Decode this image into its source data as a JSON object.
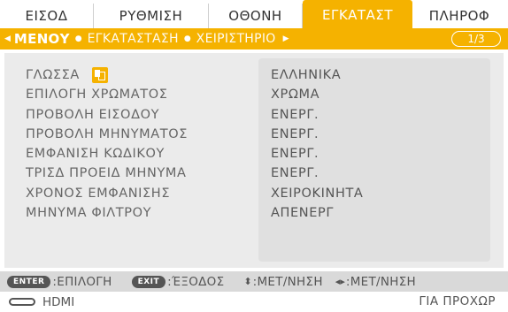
{
  "tabs": [
    {
      "label": "ΕΙΣΟΔ"
    },
    {
      "label": "ΡΥΘΜΙΣΗ"
    },
    {
      "label": "ΟΘΟΝΗ"
    },
    {
      "label": "ΕΓΚΑΤΑΣΤ"
    },
    {
      "label": "ΠΛΗΡΟΦ"
    }
  ],
  "active_tab": "ΕΓΚΑΤΑΣΤ",
  "subnav": {
    "active": "ΜΕΝΟΥ",
    "item2": "ΕΓΚΑΤΑΣΤΑΣΗ",
    "item3": "ΧΕΙΡΙΣΤΗΡΙΟ",
    "page_indicator": "1/3"
  },
  "settings": [
    {
      "label": "ΓΛΩΣΣΑ",
      "value": "ΕΛΛΗΝΙΚΑ",
      "icon": "language-icon"
    },
    {
      "label": "ΕΠΙΛΟΓΗ ΧΡΩΜΑΤΟΣ",
      "value": "ΧΡΩΜΑ"
    },
    {
      "label": "ΠΡΟΒΟΛΗ ΕΙΣΟΔΟΥ",
      "value": "ΕΝΕΡΓ."
    },
    {
      "label": "ΠΡΟΒΟΛΗ ΜΗΝΥΜΑΤΟΣ",
      "value": "ΕΝΕΡΓ."
    },
    {
      "label": "ΕΜΦΑΝΙΣΗ ΚΩΔΙΚΟΥ",
      "value": "ΕΝΕΡΓ."
    },
    {
      "label": "ΤΡΙΣΔ ΠΡΟΕΙΔ ΜΗΝΥΜΑ",
      "value": "ΕΝΕΡΓ."
    },
    {
      "label": "ΧΡΟΝΟΣ ΕΜΦΑΝΙΣΗΣ",
      "value": "ΧΕΙΡΟΚΙΝΗΤΑ"
    },
    {
      "label": "ΜΗΝΥΜΑ ΦΙΛΤΡΟΥ",
      "value": "ΑΠΕΝΕΡΓ"
    }
  ],
  "help": {
    "enter_key": "ENTER",
    "enter_text": ":ΕΠΙΛΟΓΗ",
    "exit_key": "EXIT",
    "exit_text": ":ΈΞΟΔΟΣ",
    "move_symbol": "⬍",
    "move_text": ":ΜΕΤ/ΝΗΣΗ",
    "nav_symbol": "◂▸",
    "nav_text": ":ΜΕΤ/ΝΗΣΗ"
  },
  "status": {
    "source": "HDMI",
    "right": "ΓΙΑ ΠΡΟΧΩΡ"
  },
  "colors": {
    "accent": "#f5b200",
    "panel_bg": "#ebebeb",
    "value_box_bg": "#e0e0e0",
    "help_bar_bg": "#d9d9d9",
    "text": "#555555"
  }
}
